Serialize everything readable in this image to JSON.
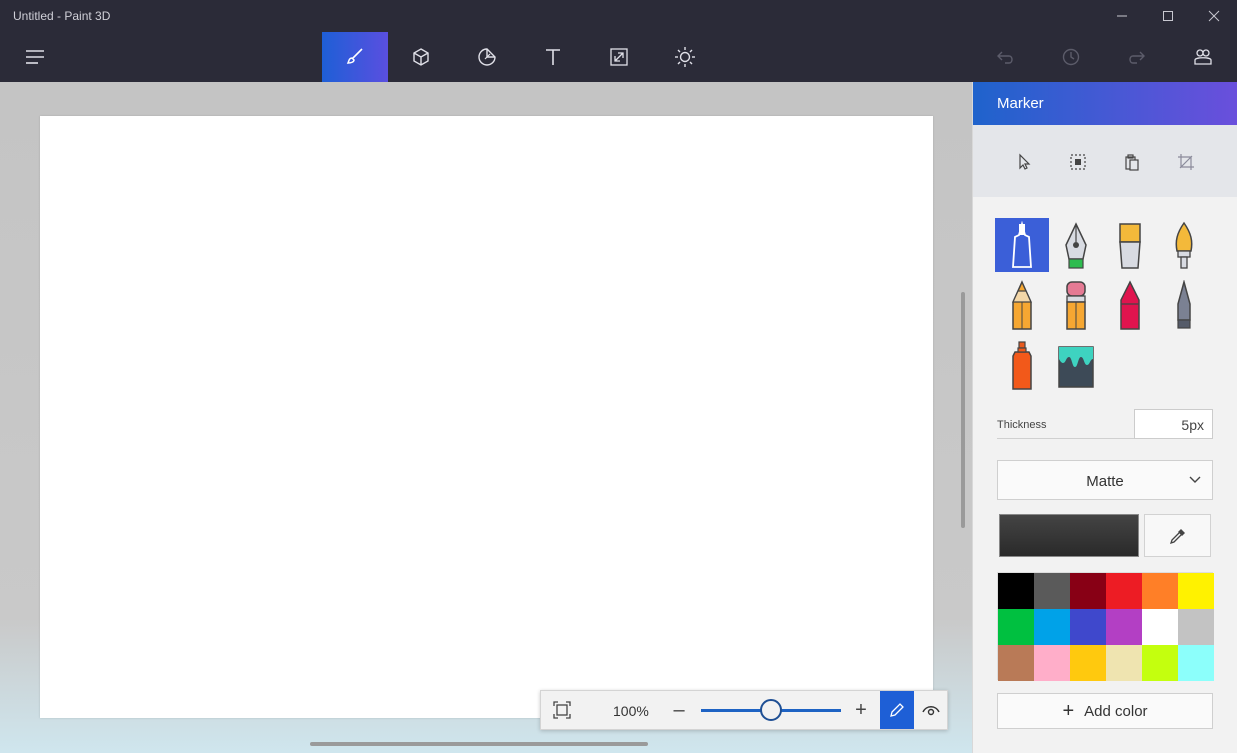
{
  "window": {
    "title": "Untitled - Paint 3D",
    "controls": [
      "minimize",
      "maximize",
      "close"
    ]
  },
  "toolbar": {
    "tools": [
      {
        "name": "brushes",
        "icon": "brush-icon",
        "active": true
      },
      {
        "name": "3d-shapes",
        "icon": "cube-icon",
        "active": false
      },
      {
        "name": "stickers",
        "icon": "sticker-icon",
        "active": false
      },
      {
        "name": "text",
        "icon": "text-icon",
        "active": false
      },
      {
        "name": "canvas",
        "icon": "resize-icon",
        "active": false
      },
      {
        "name": "effects",
        "icon": "sun-icon",
        "active": false
      }
    ],
    "right": [
      "undo-icon",
      "history-icon",
      "redo-icon",
      "people-icon"
    ]
  },
  "zoom": {
    "percent": "100%",
    "level": 0.5
  },
  "panel": {
    "title": "Marker",
    "thickness_label": "Thickness",
    "thickness_value": "5px",
    "finish_value": "Matte",
    "current_color": "#2a2a2a",
    "add_color_label": "Add color",
    "brushes": [
      "marker",
      "calligraphy-pen",
      "oil-brush",
      "watercolor",
      "pencil",
      "eraser",
      "crayon",
      "pixel-pen",
      "spray-can",
      "fill"
    ],
    "palette": [
      "#000000",
      "#5a5a5a",
      "#880015",
      "#ed1c24",
      "#ff7f27",
      "#fff200",
      "#00c040",
      "#00a2e8",
      "#3f48cc",
      "#b33fc4",
      "#ffffff",
      "#c3c3c3",
      "#b97a57",
      "#ffaec9",
      "#ffc90e",
      "#efe4b0",
      "#c4ff0e",
      "#8cfffb"
    ]
  }
}
